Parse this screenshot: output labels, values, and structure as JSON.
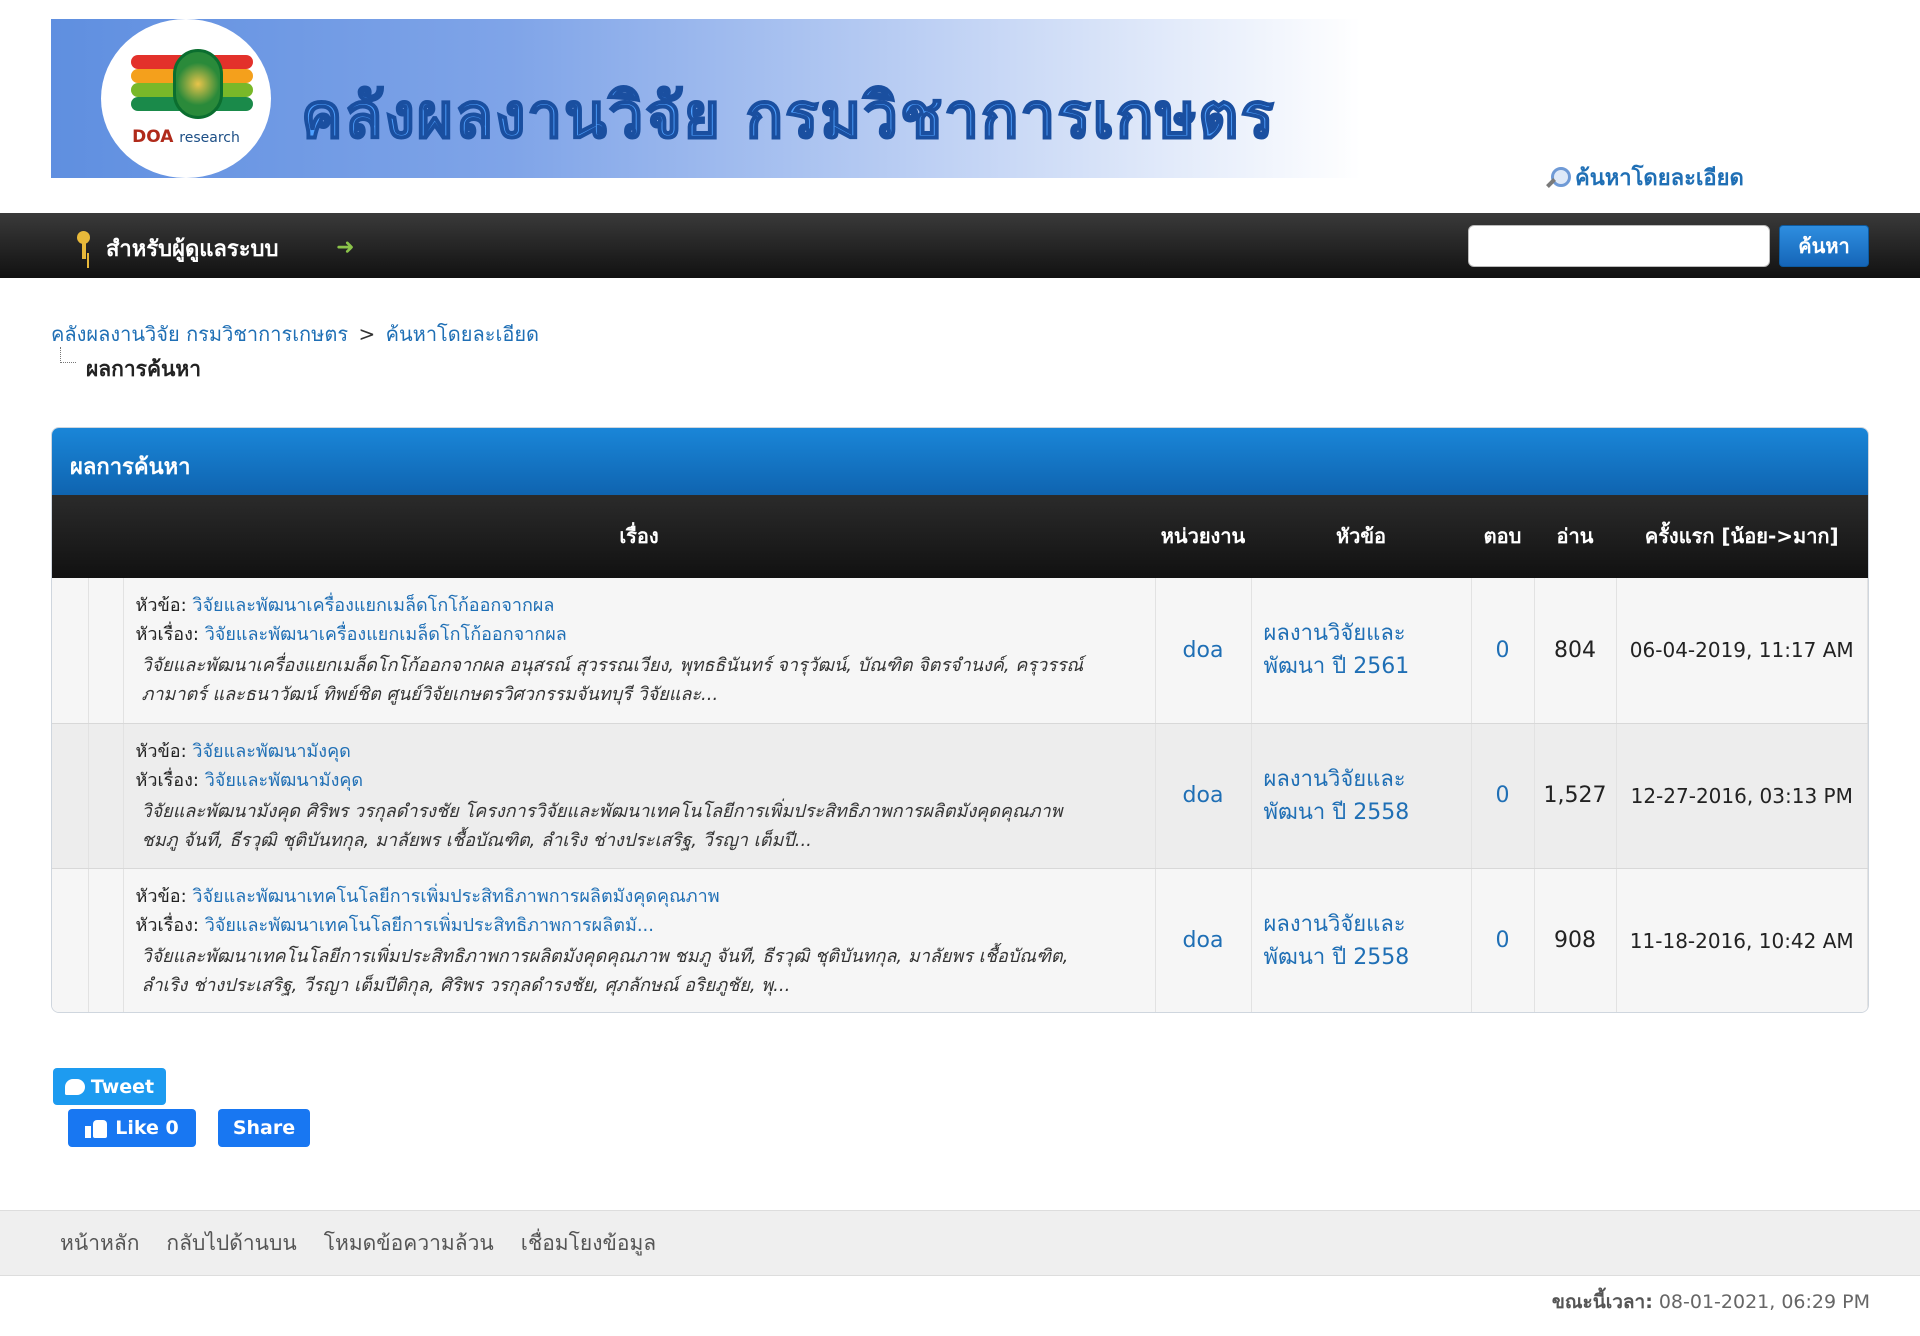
{
  "header": {
    "logo_text_bold": "DOA",
    "logo_text_rest": "research",
    "banner_title": "คลังผลงานวิจัย กรมวิชาการเกษตร",
    "advanced_search": "ค้นหาโดยละเอียด"
  },
  "navbar": {
    "admin_label": "สำหรับผู้ดูแลระบบ",
    "search_value": "",
    "search_button": "ค้นหา"
  },
  "breadcrumb": {
    "home": "คลังผลงานวิจัย กรมวิชาการเกษตร",
    "separator": ">",
    "advanced": "ค้นหาโดยละเอียด",
    "current": "ผลการค้นหา"
  },
  "panel": {
    "title": "ผลการค้นหา",
    "columns": {
      "subject": "เรื่อง",
      "unit": "หน่วยงาน",
      "topic": "หัวข้อ",
      "replies": "ตอบ",
      "reads": "อ่าน",
      "first": "ครั้งแรก [น้อย->มาก]"
    },
    "label_topic": "หัวข้อ:",
    "label_subject": "หัวเรื่อง:",
    "rows": [
      {
        "topic_title": "วิจัยและพัฒนาเครื่องแยกเมล็ดโกโก้ออกจากผล",
        "subject_title": "วิจัยและพัฒนาเครื่องแยกเมล็ดโกโก้ออกจากผล",
        "excerpt_1": "วิจัยและพัฒนาเครื่องแยกเมล็ดโกโก้ออกจากผล อนุสรณ์ สุวรรณเวียง, พุทธธินันทร์ จารุวัฒน์, บัณฑิต จิตรจำนงค์, ครุวรรณ์",
        "excerpt_2": "ภามาตร์ และธนาวัฒน์ ทิพย์ชิต ศูนย์วิจัยเกษตรวิศวกรรมจันทบุรี           วิจัยและ...",
        "unit": "doa",
        "forum_1": "ผลงานวิจัยและ",
        "forum_2": "พัฒนา ปี 2561",
        "replies": "0",
        "reads": "804",
        "date": "06-04-2019, 11:17 AM"
      },
      {
        "topic_title": "วิจัยและพัฒนามังคุด",
        "subject_title": "วิจัยและพัฒนามังคุด",
        "excerpt_1": "วิจัยและพัฒนามังคุด ศิริพร วรกุลดำรงชัย โครงการวิจัยและพัฒนาเทคโนโลยีการเพิ่มประสิทธิภาพการผลิตมังคุดคุณภาพ",
        "excerpt_2": "ชมภู จันที, ธีรวุฒิ ชุติบันทกุล, มาลัยพร เชื้อบัณฑิต, ลำเริง ช่างประเสริฐ, วีรญา เต็มปี...",
        "unit": "doa",
        "forum_1": "ผลงานวิจัยและ",
        "forum_2": "พัฒนา ปี 2558",
        "replies": "0",
        "reads": "1,527",
        "date": "12-27-2016, 03:13 PM"
      },
      {
        "topic_title": "วิจัยและพัฒนาเทคโนโลยีการเพิ่มประสิทธิภาพการผลิตมังคุดคุณภาพ",
        "subject_title": "วิจัยและพัฒนาเทคโนโลยีการเพิ่มประสิทธิภาพการผลิตมั...",
        "excerpt_1": "วิจัยและพัฒนาเทคโนโลยีการเพิ่มประสิทธิภาพการผลิตมังคุดคุณภาพ ชมภู จันที, ธีรวุฒิ ชุติบันทกุล, มาลัยพร เชื้อบัณฑิต,",
        "excerpt_2": "ลำเริง ช่างประเสริฐ, วีรญา เต็มปีติกุล, ศิริพร วรกุลดำรงชัย, ศุภลักษณ์ อริยภูชัย, พุ...",
        "unit": "doa",
        "forum_1": "ผลงานวิจัยและ",
        "forum_2": "พัฒนา ปี 2558",
        "replies": "0",
        "reads": "908",
        "date": "11-18-2016, 10:42 AM"
      }
    ]
  },
  "social": {
    "tweet": "Tweet",
    "like": "Like 0",
    "share": "Share"
  },
  "footer": {
    "links": [
      "หน้าหลัก",
      "กลับไปด้านบน",
      "โหมดข้อความล้วน",
      "เชื่อมโยงข้อมูล"
    ],
    "time_label": "ขณะนี้เวลา:",
    "time_value": "08-01-2021, 06:29 PM"
  },
  "colors": {
    "accent": "#1f6fb5",
    "panel_header": "#1a86d8",
    "navbar": "#1a1a1a"
  }
}
